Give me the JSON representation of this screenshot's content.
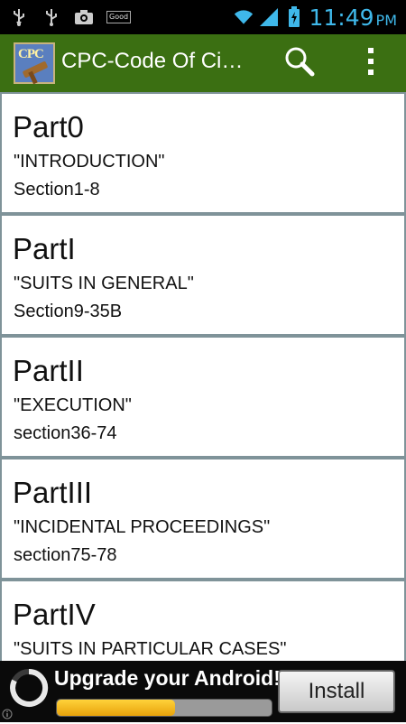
{
  "status_bar": {
    "icons": [
      "usb-icon",
      "usb-icon",
      "camera-icon",
      "good-icon",
      "wifi-icon",
      "signal-icon",
      "battery-icon"
    ],
    "good_label": "Good",
    "time": "11:49",
    "ampm": "PM",
    "accent": "#3fb8ea"
  },
  "action_bar": {
    "logo_text": "CPC",
    "title": "CPC-Code Of Ci…",
    "icons": [
      "search-icon",
      "overflow-menu-icon"
    ],
    "background": "#3b6f12"
  },
  "parts": [
    {
      "title": "Part0",
      "subtitle": "\"INTRODUCTION\"",
      "sections": "Section1-8"
    },
    {
      "title": "PartI",
      "subtitle": "\"SUITS IN GENERAL\"",
      "sections": "Section9-35B"
    },
    {
      "title": "PartII",
      "subtitle": "\"EXECUTION\"",
      "sections": "section36-74"
    },
    {
      "title": "PartIII",
      "subtitle": "\"INCIDENTAL PROCEEDINGS\"",
      "sections": "section75-78"
    },
    {
      "title": "PartIV",
      "subtitle": "\"SUITS IN PARTICULAR CASES\"",
      "sections": ""
    }
  ],
  "ad": {
    "text": "Upgrade your Android!",
    "install_label": "Install",
    "progress": 0.55,
    "icons": [
      "spinner-icon",
      "info-icon"
    ]
  }
}
